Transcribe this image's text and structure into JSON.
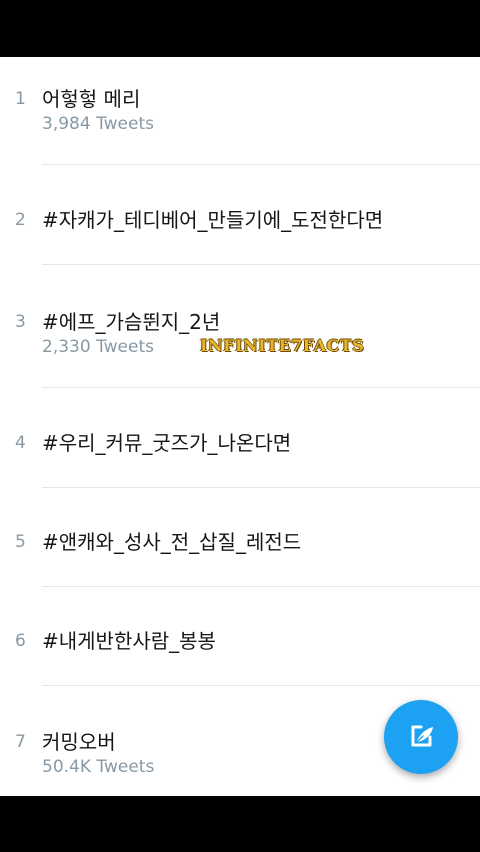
{
  "trends": [
    {
      "rank": "1",
      "name": "어헣헣 메리",
      "count": "3,984 Tweets"
    },
    {
      "rank": "2",
      "name": "#자캐가_테디베어_만들기에_도전한다면",
      "count": ""
    },
    {
      "rank": "3",
      "name": "#에프_가슴뛴지_2년",
      "count": "2,330 Tweets"
    },
    {
      "rank": "4",
      "name": "#우리_커뮤_굿즈가_나온다면",
      "count": ""
    },
    {
      "rank": "5",
      "name": "#앤캐와_성사_전_삽질_레전드",
      "count": ""
    },
    {
      "rank": "6",
      "name": "#내게반한사람_봉봉",
      "count": ""
    },
    {
      "rank": "7",
      "name": "커밍오버",
      "count": "50.4K Tweets"
    }
  ],
  "watermark": "INFINITE7FACTS",
  "fab": {
    "icon": "compose-tweet-icon"
  },
  "colors": {
    "accent": "#1da1f2",
    "primary_text": "#14171a",
    "secondary_text": "#8899a6",
    "divider": "#e1e8ed",
    "watermark": "#e8b52c"
  }
}
